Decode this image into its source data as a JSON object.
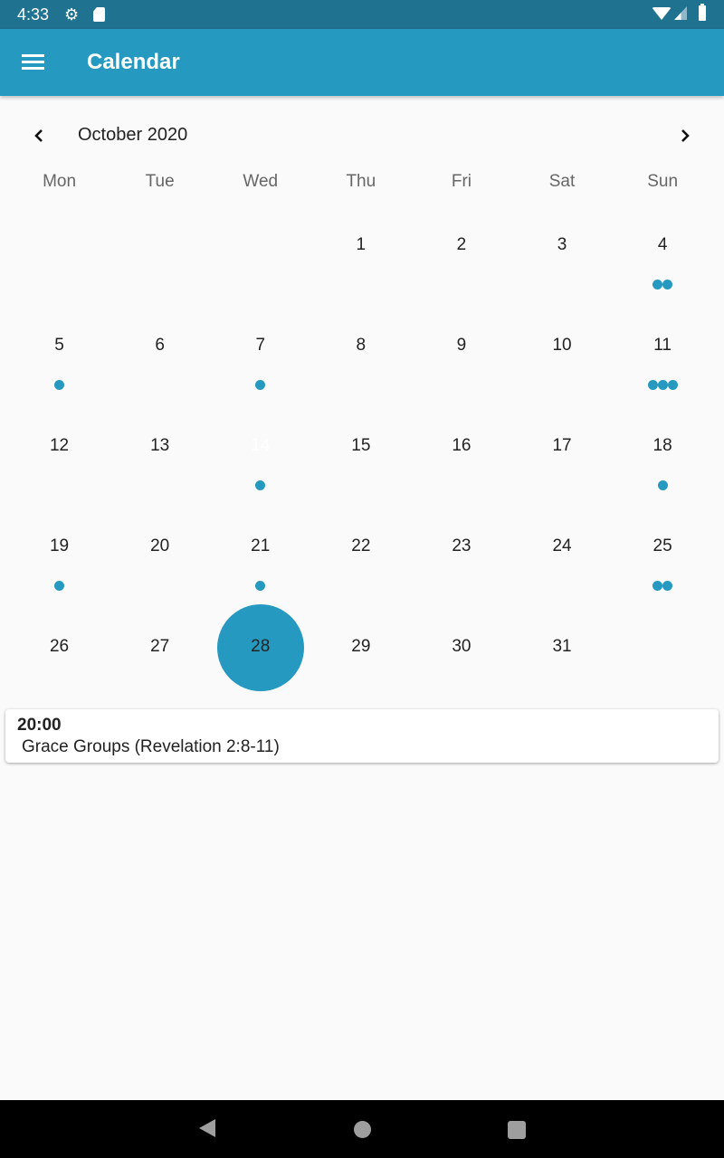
{
  "status_bar": {
    "time": "4:33",
    "icons": [
      "gear-icon",
      "sd-card-icon",
      "wifi-icon",
      "cell-signal-icon",
      "battery-icon"
    ]
  },
  "app_bar": {
    "title": "Calendar",
    "menu_icon": "hamburger-menu-icon"
  },
  "calendar": {
    "month_label": "October 2020",
    "prev_icon": "chevron-left-icon",
    "next_icon": "chevron-right-icon",
    "weekdays": [
      "Mon",
      "Tue",
      "Wed",
      "Thu",
      "Fri",
      "Sat",
      "Sun"
    ],
    "selected_day": 14,
    "accent_color": "#2699c0",
    "weeks": [
      [
        null,
        null,
        null,
        {
          "day": "1",
          "events": 0
        },
        {
          "day": "2",
          "events": 0
        },
        {
          "day": "3",
          "events": 0
        },
        {
          "day": "4",
          "events": 2
        }
      ],
      [
        {
          "day": "5",
          "events": 1
        },
        {
          "day": "6",
          "events": 0
        },
        {
          "day": "7",
          "events": 1
        },
        {
          "day": "8",
          "events": 0
        },
        {
          "day": "9",
          "events": 0
        },
        {
          "day": "10",
          "events": 0
        },
        {
          "day": "11",
          "events": 3
        }
      ],
      [
        {
          "day": "12",
          "events": 0
        },
        {
          "day": "13",
          "events": 0
        },
        {
          "day": "14",
          "events": 1
        },
        {
          "day": "15",
          "events": 0
        },
        {
          "day": "16",
          "events": 0
        },
        {
          "day": "17",
          "events": 0
        },
        {
          "day": "18",
          "events": 1
        }
      ],
      [
        {
          "day": "19",
          "events": 1
        },
        {
          "day": "20",
          "events": 0
        },
        {
          "day": "21",
          "events": 1
        },
        {
          "day": "22",
          "events": 0
        },
        {
          "day": "23",
          "events": 0
        },
        {
          "day": "24",
          "events": 0
        },
        {
          "day": "25",
          "events": 2
        }
      ],
      [
        {
          "day": "26",
          "events": 0
        },
        {
          "day": "27",
          "events": 0
        },
        {
          "day": "28",
          "events": 1
        },
        {
          "day": "29",
          "events": 0
        },
        {
          "day": "30",
          "events": 0
        },
        {
          "day": "31",
          "events": 0
        },
        null
      ]
    ]
  },
  "events": [
    {
      "time": "20:00",
      "title": "Grace Groups (Revelation 2:8-11)"
    }
  ],
  "nav_bar": {
    "buttons": [
      "back-icon",
      "home-icon",
      "recents-icon"
    ]
  }
}
